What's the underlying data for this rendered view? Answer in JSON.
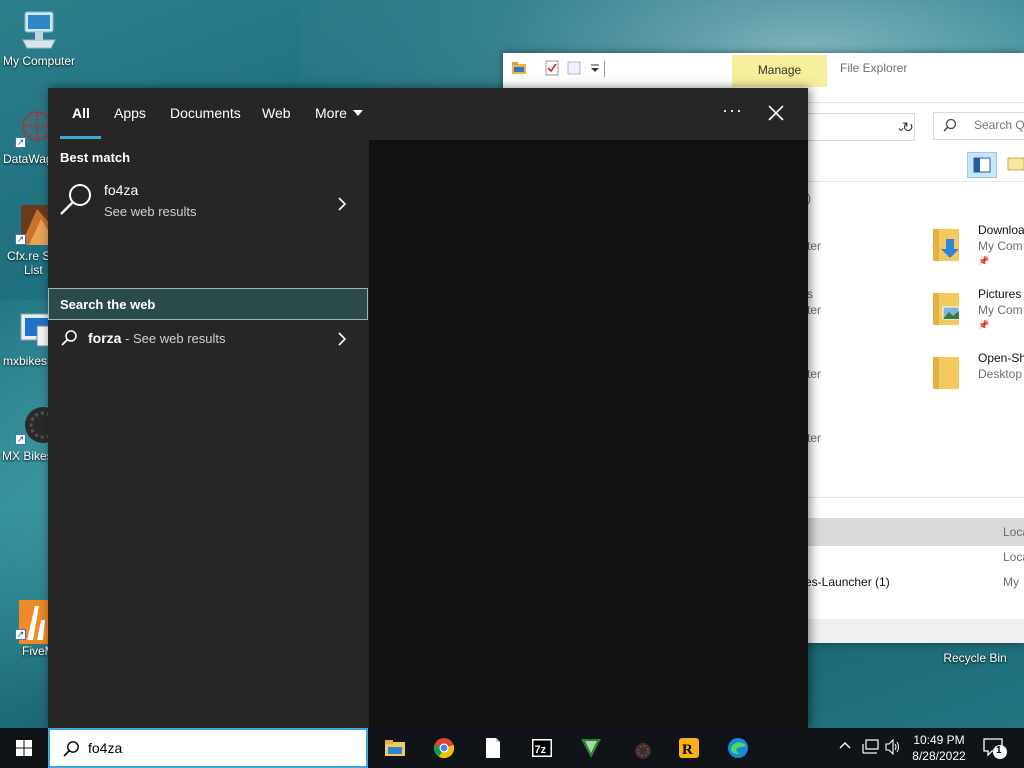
{
  "desktop": {
    "icons": [
      {
        "label": "My Computer"
      },
      {
        "label": "DataWag"
      },
      {
        "label": "Cfx.re S",
        "label2": "List"
      },
      {
        "label": "mxbikes"
      },
      {
        "label": "MX Bikes"
      },
      {
        "label": "FiveM"
      },
      {
        "label": "Recycle Bin"
      }
    ]
  },
  "explorer": {
    "manage_tab": "Manage",
    "title": "File Explorer",
    "search_placeholder": "Search Qu",
    "quick_access": [
      {
        "name": "Downloa",
        "sub": "My Com"
      },
      {
        "name": "Pictures",
        "sub": "My Com"
      },
      {
        "name": "Open-Sh",
        "sub": "Desktop"
      }
    ],
    "hidden_fragments": {
      "paren": ")",
      "items": [
        "ter",
        "s",
        "ter",
        "ter",
        "ter"
      ]
    },
    "recent": {
      "row1_right": "Loca",
      "row2_right": "Loca",
      "row3_name": "es-Launcher (1)",
      "row3_right": "My"
    }
  },
  "search_flyout": {
    "tabs": [
      {
        "label": "All",
        "active": true
      },
      {
        "label": "Apps"
      },
      {
        "label": "Documents"
      },
      {
        "label": "Web"
      },
      {
        "label": "More"
      }
    ],
    "ellipsis": "···",
    "best_match_header": "Best match",
    "best_match": {
      "title": "fo4za",
      "subtitle": "See web results"
    },
    "search_web_header": "Search the web",
    "web_suggestion": {
      "term": "forza",
      "suffix": " - See web results"
    }
  },
  "taskbar": {
    "search_value": "fo4za",
    "clock_time": "10:49 PM",
    "clock_date": "8/28/2022",
    "notification_count": "1",
    "apps": [
      "file-explorer",
      "chrome",
      "notepad-file",
      "7zip",
      "vegas",
      "mxbikes",
      "rockstar",
      "edge"
    ]
  },
  "colors": {
    "accent": "#3ea7db",
    "flyout_left": "#262626",
    "flyout_right": "#121212",
    "search_web_highlight": "#2b4b4a",
    "manage_tab": "#f6ef9c",
    "taskbar": "#101418"
  }
}
